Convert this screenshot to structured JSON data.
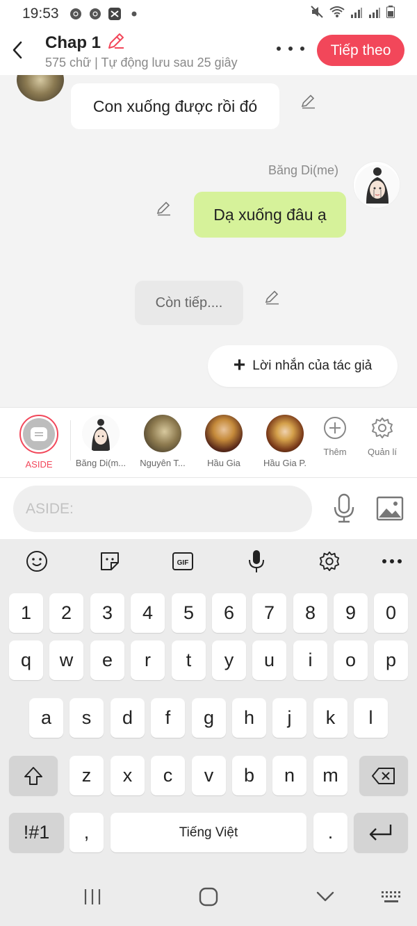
{
  "status_bar": {
    "time": "19:53"
  },
  "header": {
    "title": "Chap 1",
    "subtitle": "575 chữ | Tự động lưu sau 25 giây",
    "next_button": "Tiếp theo"
  },
  "chat": {
    "messages": [
      {
        "text": "Con xuống được rồi đó"
      },
      {
        "sender": "Băng Di(me)",
        "text": "Dạ xuống đâu ạ"
      },
      {
        "text": "Còn tiếp...."
      }
    ],
    "author_note_label": "Lời nhắn của tác giả"
  },
  "characters": [
    {
      "label": "ASIDE"
    },
    {
      "label": "Băng Di(m..."
    },
    {
      "label": "Nguyên T..."
    },
    {
      "label": "Hầu Gia"
    },
    {
      "label": "Hầu Gia P."
    }
  ],
  "tools": {
    "add_label": "Thêm",
    "manage_label": "Quản lí"
  },
  "input": {
    "placeholder": "ASIDE:"
  },
  "keyboard": {
    "row_numbers": [
      "1",
      "2",
      "3",
      "4",
      "5",
      "6",
      "7",
      "8",
      "9",
      "0"
    ],
    "row_1": [
      "q",
      "w",
      "e",
      "r",
      "t",
      "y",
      "u",
      "i",
      "o",
      "p"
    ],
    "row_2": [
      "a",
      "s",
      "d",
      "f",
      "g",
      "h",
      "j",
      "k",
      "l"
    ],
    "row_3": [
      "z",
      "x",
      "c",
      "v",
      "b",
      "n",
      "m"
    ],
    "symbols_key": "!#1",
    "comma_key": ",",
    "space_label": "Tiếng Việt",
    "period_key": ".",
    "gif_label": "GIF"
  },
  "colors": {
    "accent": "#f2475a",
    "bubble_me": "#d6f29a"
  }
}
